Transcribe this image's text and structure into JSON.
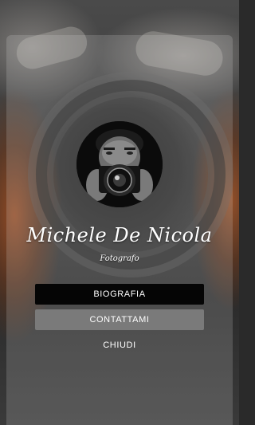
{
  "profile": {
    "name": "Michele De Nicola",
    "role": "Fotografo"
  },
  "menu": {
    "biography_label": "BIOGRAFIA",
    "contact_label": "CONTATTAMI",
    "close_label": "CHIUDI"
  },
  "colors": {
    "primary_button": "#050505",
    "secondary_button": "#7a7a7a",
    "text": "#ffffff"
  },
  "icons": {
    "avatar": "photographer-with-camera-photo"
  }
}
